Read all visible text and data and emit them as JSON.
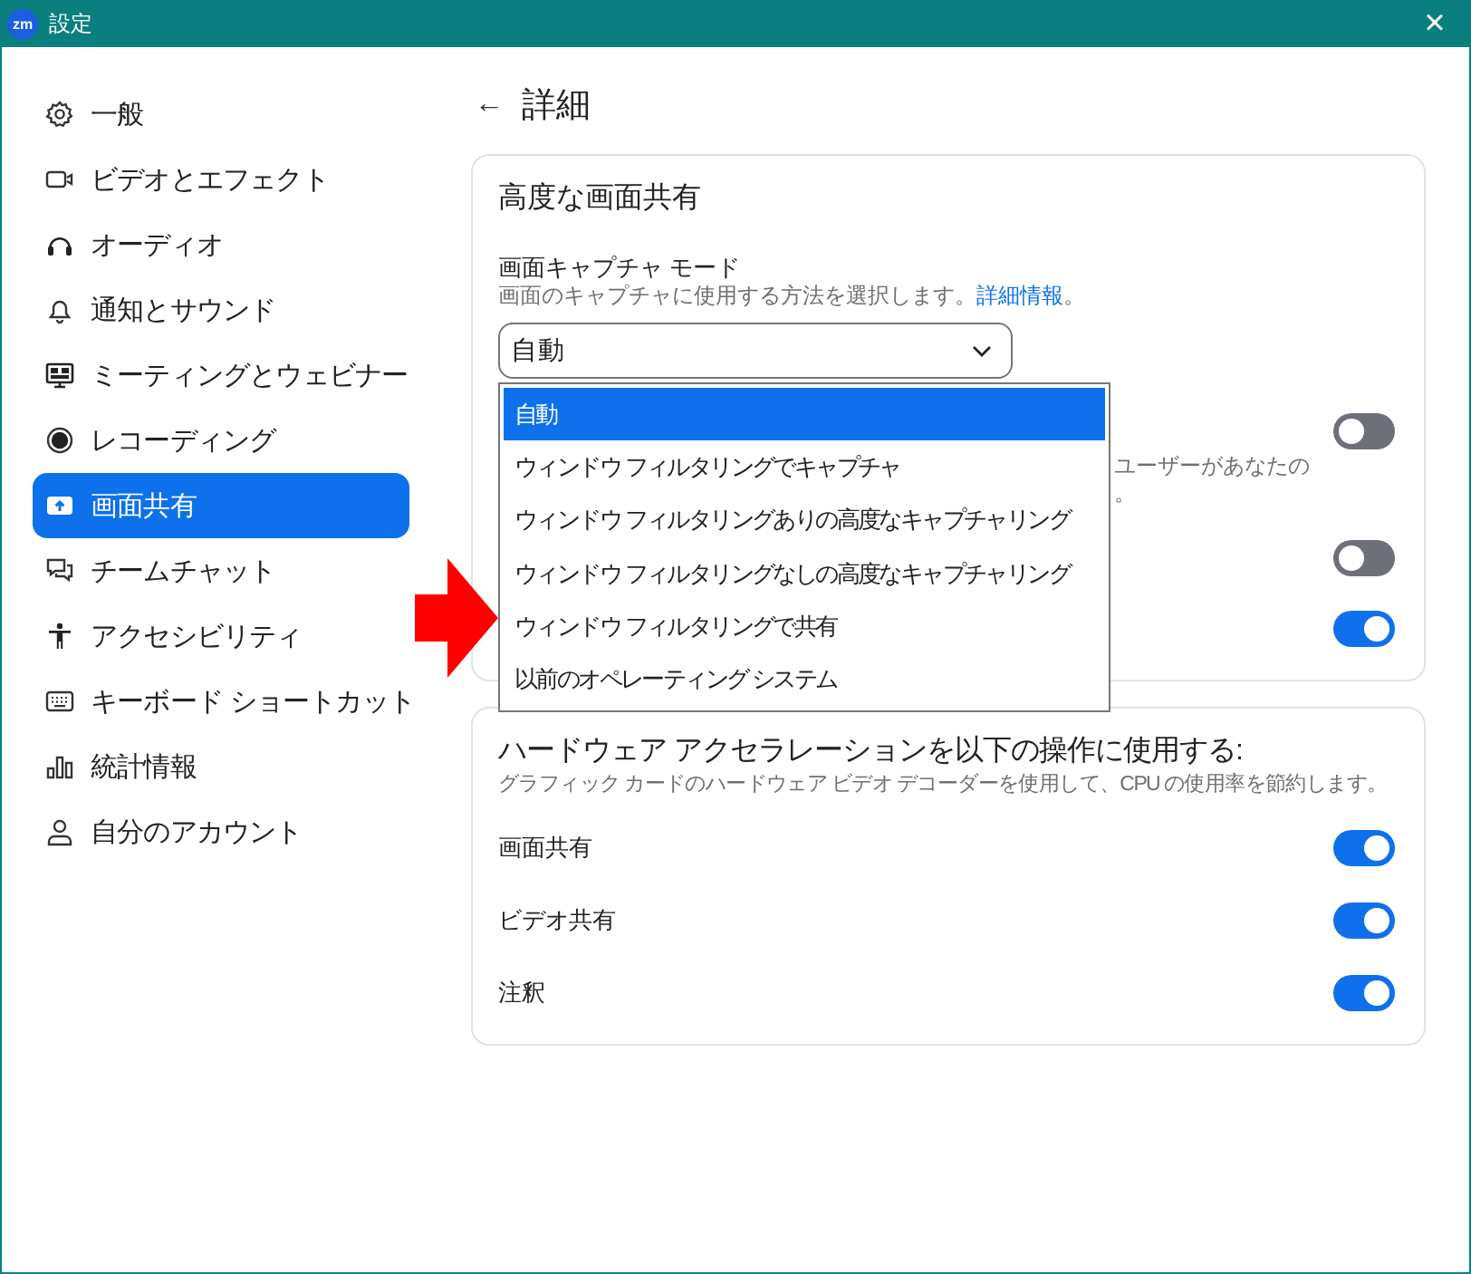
{
  "window": {
    "title": "設定",
    "app_icon": "zm",
    "close": "×"
  },
  "sidebar": {
    "items": [
      {
        "label": "一般",
        "selected": false
      },
      {
        "label": "ビデオとエフェクト",
        "selected": false
      },
      {
        "label": "オーディオ",
        "selected": false
      },
      {
        "label": "通知とサウンド",
        "selected": false
      },
      {
        "label": "ミーティングとウェビナー",
        "selected": false
      },
      {
        "label": "レコーディング",
        "selected": false
      },
      {
        "label": "画面共有",
        "selected": true
      },
      {
        "label": "チームチャット",
        "selected": false
      },
      {
        "label": "アクセシビリティ",
        "selected": false
      },
      {
        "label": "キーボード ショートカット",
        "selected": false
      },
      {
        "label": "統計情報",
        "selected": false
      },
      {
        "label": "自分のアカウント",
        "selected": false
      }
    ]
  },
  "page": {
    "back": "←",
    "title": "詳細"
  },
  "advanced_sharing": {
    "title": "高度な画面共有",
    "capture_mode": {
      "label": "画面キャプチャ モード",
      "description": "画面のキャプチャに使用する方法を選択します。",
      "link": "詳細情報",
      "description_end": "。",
      "value": "自動",
      "options": [
        {
          "label": "自動",
          "selected": true
        },
        {
          "label": "ウィンドウ フィルタリングでキャプチャ",
          "selected": false
        },
        {
          "label": "ウィンドウ フィルタリングありの高度なキャプチャリング",
          "selected": false
        },
        {
          "label": "ウィンドウ フィルタリングなしの高度なキャプチャリング",
          "selected": false
        },
        {
          "label": "ウィンドウ フィルタリングで共有",
          "selected": false
        },
        {
          "label": "以前のオペレーティング システム",
          "selected": false
        }
      ]
    },
    "toggles": [
      {
        "visible_text": [
          "ユーザーがあなたの",
          "。"
        ],
        "on": false
      },
      {
        "on": false
      },
      {
        "on": true
      }
    ]
  },
  "hardware_acceleration": {
    "title": "ハードウェア アクセラレーションを以下の操作に使用する:",
    "description": "グラフィック カードのハードウェア ビデオ デコーダーを使用して、CPU の使用率を節約します。",
    "toggles": [
      {
        "label": "画面共有",
        "on": true
      },
      {
        "label": "ビデオ共有",
        "on": true
      },
      {
        "label": "注釈",
        "on": true
      }
    ]
  }
}
